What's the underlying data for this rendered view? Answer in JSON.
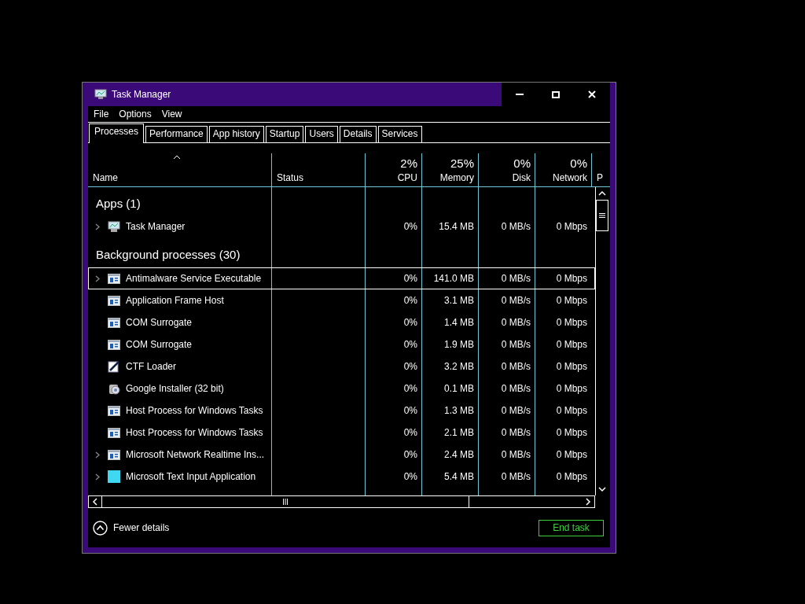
{
  "window": {
    "title": "Task Manager"
  },
  "menu": [
    "File",
    "Options",
    "View"
  ],
  "tabs": [
    {
      "label": "Processes",
      "selected": true
    },
    {
      "label": "Performance",
      "selected": false
    },
    {
      "label": "App history",
      "selected": false
    },
    {
      "label": "Startup",
      "selected": false
    },
    {
      "label": "Users",
      "selected": false
    },
    {
      "label": "Details",
      "selected": false
    },
    {
      "label": "Services",
      "selected": false
    }
  ],
  "table": {
    "columns": [
      {
        "label": "Name",
        "sorted": true
      },
      {
        "label": "Status",
        "sorted": false
      },
      {
        "label": "CPU",
        "usage": "2%",
        "sorted": false
      },
      {
        "label": "Memory",
        "usage": "25%",
        "sorted": false
      },
      {
        "label": "Disk",
        "usage": "0%",
        "sorted": false
      },
      {
        "label": "Network",
        "usage": "0%",
        "sorted": false
      },
      {
        "label": "P",
        "sorted": false
      }
    ],
    "rows": [
      {
        "kind": "group",
        "title": "Apps (1)"
      },
      {
        "kind": "process",
        "name": "Task Manager",
        "expandable": true,
        "selected": false,
        "cpu": "0%",
        "memory": "15.4 MB",
        "disk": "0 MB/s",
        "network": "0 Mbps"
      },
      {
        "kind": "group",
        "title": "Background processes (30)"
      },
      {
        "kind": "process",
        "name": "Antimalware Service Executable",
        "expandable": true,
        "selected": true,
        "cpu": "0%",
        "memory": "141.0 MB",
        "disk": "0 MB/s",
        "network": "0 Mbps"
      },
      {
        "kind": "process",
        "name": "Application Frame Host",
        "expandable": false,
        "selected": false,
        "cpu": "0%",
        "memory": "3.1 MB",
        "disk": "0 MB/s",
        "network": "0 Mbps"
      },
      {
        "kind": "process",
        "name": "COM Surrogate",
        "expandable": false,
        "selected": false,
        "cpu": "0%",
        "memory": "1.4 MB",
        "disk": "0 MB/s",
        "network": "0 Mbps"
      },
      {
        "kind": "process",
        "name": "COM Surrogate",
        "expandable": false,
        "selected": false,
        "cpu": "0%",
        "memory": "1.9 MB",
        "disk": "0 MB/s",
        "network": "0 Mbps"
      },
      {
        "kind": "process",
        "name": "CTF Loader",
        "expandable": false,
        "selected": false,
        "cpu": "0%",
        "memory": "3.2 MB",
        "disk": "0 MB/s",
        "network": "0 Mbps"
      },
      {
        "kind": "process",
        "name": "Google Installer (32 bit)",
        "expandable": false,
        "selected": false,
        "cpu": "0%",
        "memory": "0.1 MB",
        "disk": "0 MB/s",
        "network": "0 Mbps"
      },
      {
        "kind": "process",
        "name": "Host Process for Windows Tasks",
        "expandable": false,
        "selected": false,
        "cpu": "0%",
        "memory": "1.3 MB",
        "disk": "0 MB/s",
        "network": "0 Mbps"
      },
      {
        "kind": "process",
        "name": "Host Process for Windows Tasks",
        "expandable": false,
        "selected": false,
        "cpu": "0%",
        "memory": "2.1 MB",
        "disk": "0 MB/s",
        "network": "0 Mbps"
      },
      {
        "kind": "process",
        "name": "Microsoft Network Realtime Ins...",
        "expandable": true,
        "selected": false,
        "cpu": "0%",
        "memory": "2.4 MB",
        "disk": "0 MB/s",
        "network": "0 Mbps"
      },
      {
        "kind": "process",
        "name": "Microsoft Text Input Application",
        "expandable": true,
        "selected": false,
        "cpu": "0%",
        "memory": "5.4 MB",
        "disk": "0 MB/s",
        "network": "0 Mbps"
      }
    ]
  },
  "footer": {
    "details_link": "Fewer details",
    "end_button": "End task"
  }
}
